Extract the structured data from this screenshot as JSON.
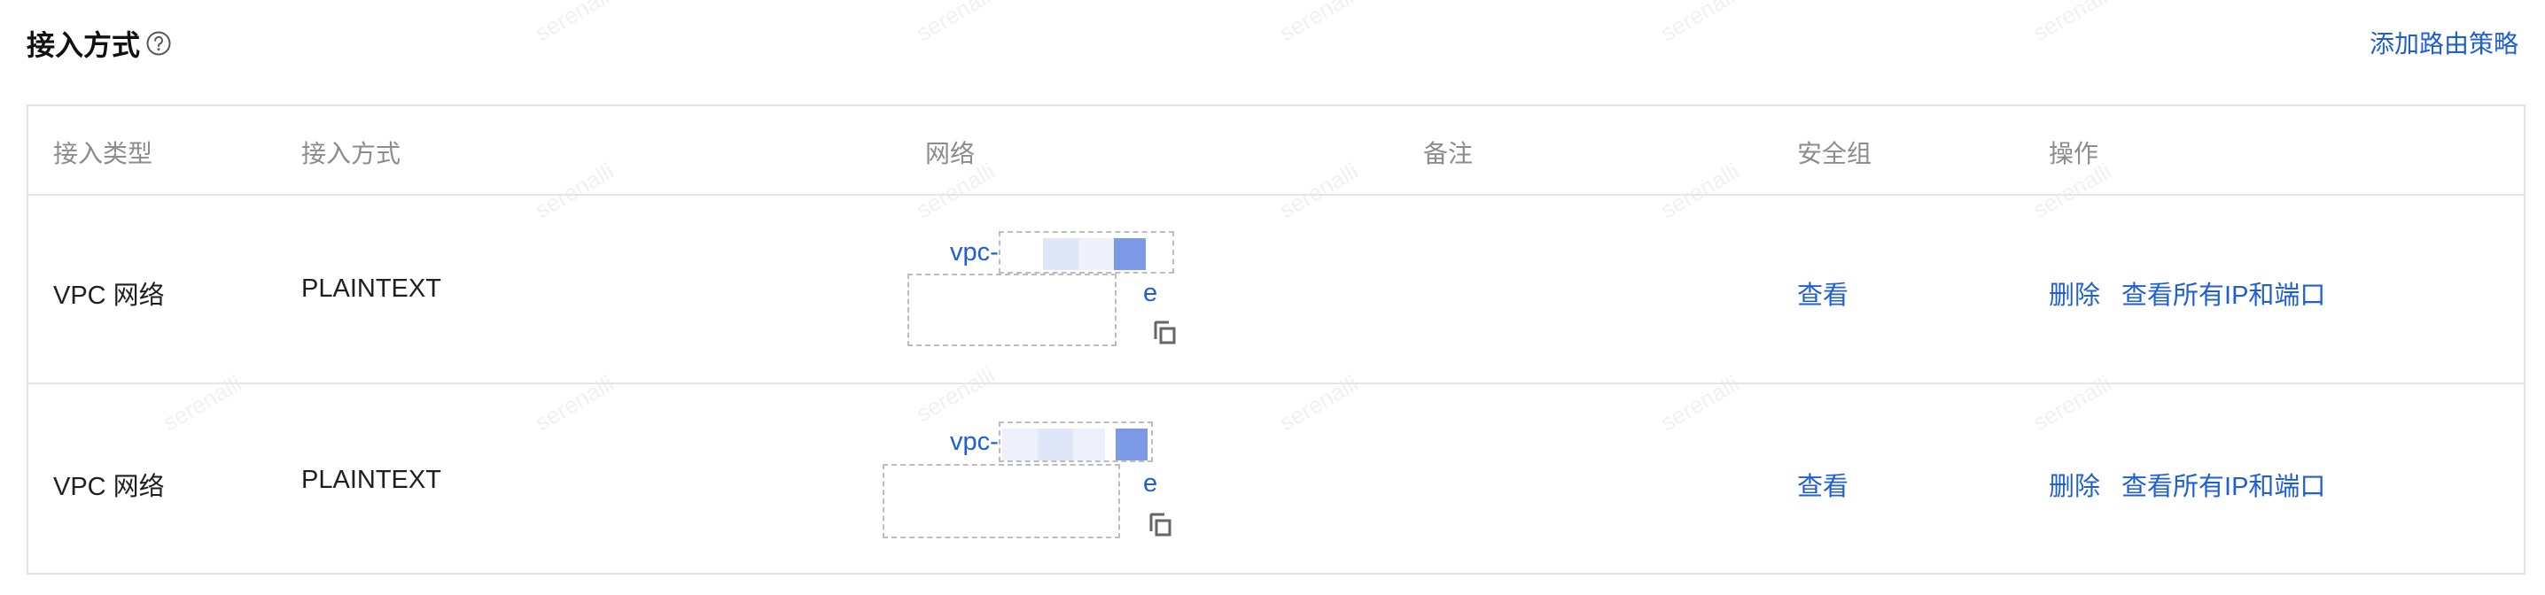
{
  "header": {
    "title": "接入方式",
    "help_icon": "question-circle-icon",
    "action_label": "添加路由策略"
  },
  "watermark_text": "serenalli",
  "table": {
    "columns": [
      "接入类型",
      "接入方式",
      "网络",
      "备注",
      "安全组",
      "操作"
    ],
    "rows": [
      {
        "access_type": "VPC 网络",
        "access_method": "PLAINTEXT",
        "network_prefix": "vpc-",
        "network_suffix": "e",
        "remark": "",
        "security_group": "查看",
        "op_delete": "删除",
        "op_view_all": "查看所有IP和端口"
      },
      {
        "access_type": "VPC 网络",
        "access_method": "PLAINTEXT",
        "network_prefix": "vpc-",
        "network_suffix": "e",
        "remark": "",
        "security_group": "查看",
        "op_delete": "删除",
        "op_view_all": "查看所有IP和端口"
      }
    ]
  },
  "colors": {
    "link": "#1f5fd6",
    "header_text": "#8c8c8c",
    "border": "#e2e2e2"
  }
}
